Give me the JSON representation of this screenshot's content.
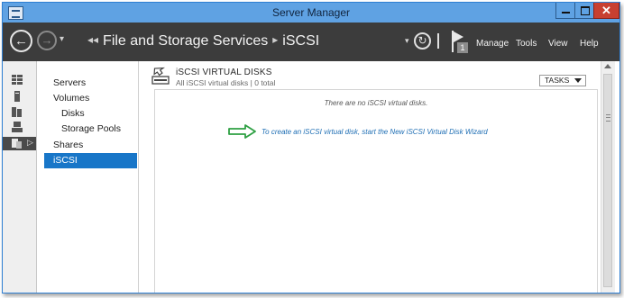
{
  "window": {
    "title": "Server Manager",
    "close_glyph": "✕"
  },
  "navbar": {
    "back_glyph": "←",
    "forward_glyph": "→",
    "dropdown_glyph": "▾",
    "breadcrumb": [
      "File and Storage Services",
      "iSCSI"
    ],
    "breadcrumb_sep": "◂◂",
    "breadcrumb_sep2": "▸",
    "refresh_glyph": "↻",
    "notification_count": "1",
    "menu": {
      "manage": "Manage",
      "tools": "Tools",
      "view": "View",
      "help": "Help"
    }
  },
  "icons": {
    "back": "back-arrow-icon",
    "forward": "forward-arrow-icon",
    "refresh": "refresh-icon",
    "notifications": "flag-icon",
    "rail": [
      "dashboard-icon",
      "local-server-icon",
      "all-servers-icon",
      "file-storage-icon",
      "file-services-icon"
    ],
    "tile": "iscsi-disk-icon"
  },
  "sidebar": {
    "items": [
      {
        "label": "Servers",
        "level": 1
      },
      {
        "label": "Volumes",
        "level": 1
      },
      {
        "label": "Disks",
        "level": 2
      },
      {
        "label": "Storage Pools",
        "level": 2
      },
      {
        "label": "Shares",
        "level": 1
      },
      {
        "label": "iSCSI",
        "level": 1,
        "selected": true
      }
    ]
  },
  "tile": {
    "title": "iSCSI VIRTUAL DISKS",
    "subtitle": "All iSCSI virtual disks | 0 total",
    "tasks_label": "TASKS",
    "empty_message": "There are no iSCSI virtual disks.",
    "wizard_link": "To create an iSCSI virtual disk, start the New iSCSI Virtual Disk Wizard"
  },
  "colors": {
    "titlebar": "#5fa2e3",
    "navbar": "#3c3c3c",
    "selection": "#1876c8",
    "link": "#1e6eb4",
    "callout": "#2ea043",
    "close_button": "#c84031"
  }
}
